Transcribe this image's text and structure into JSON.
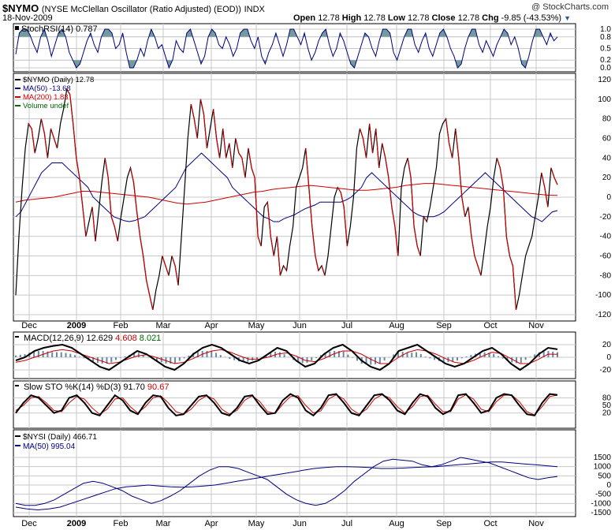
{
  "header": {
    "symbol": "$NYMO",
    "name": "(NYSE McClellan Oscillator (Ratio Adjusted) (EOD))",
    "exchange": "INDX",
    "date": "18-Nov-2009",
    "watermark": "@ StockCharts.com",
    "open_label": "Open",
    "open": "12.78",
    "high_label": "High",
    "high": "12.78",
    "low_label": "Low",
    "low": "12.78",
    "close_label": "Close",
    "close": "12.78",
    "chg_label": "Chg",
    "chg": "-9.85 (-43.53%)"
  },
  "colors": {
    "black": "#000000",
    "navy": "#00007f",
    "red": "#cc0000",
    "green": "#006600",
    "hist": "#6688aa",
    "teal": "#5a8a8a",
    "grid": "#c8c8c8",
    "axis": "#333333"
  },
  "chart_data": [
    {
      "id": "stochrsi",
      "type": "area",
      "legend": "StochRSI(14) 0.787",
      "ylim": [
        0,
        1.0
      ],
      "yticks": [
        "1.0",
        "0.8",
        "0.5",
        "0.2",
        "0.0"
      ],
      "ytick_values": [
        1.0,
        0.8,
        0.5,
        0.2,
        0.0
      ],
      "series": [
        {
          "values": [
            0.35,
            0.9,
            1,
            1,
            0.85,
            0.6,
            0.4,
            0.8,
            1,
            0.7,
            0.3,
            0.6,
            0.9,
            1,
            0.8,
            0.4,
            0.2,
            0,
            0.1,
            0.4,
            0.7,
            0.9,
            0.6,
            0.4,
            0.8,
            1,
            1,
            0.9,
            0.5,
            0.6,
            0.9,
            0.4,
            0,
            0,
            0.2,
            0.5,
            0.3,
            0.7,
            1,
            0.8,
            0.5,
            0.6,
            0.3,
            0,
            0.2,
            0.7,
            0.5,
            0.4,
            0.9,
            1,
            0.7,
            0.4,
            0.1,
            0.3,
            0.8,
            1,
            0.9,
            0.6,
            0.5,
            0.8,
            0.6,
            0.3,
            0.5,
            0.9,
            1,
            1,
            0.7,
            0.5,
            0.8,
            0.3,
            0.1,
            0.4,
            0.6,
            0.9,
            0.6,
            0.3,
            0.6,
            1,
            1,
            0.8,
            0.6,
            0.9,
            0.5,
            0.2,
            0.4,
            0.7,
            0.9,
            1,
            0.6,
            0.3,
            0.5,
            0.9,
            0.7,
            0.4,
            0.1,
            0,
            0.3,
            0.6,
            0.9,
            0.8,
            0.5,
            0.3,
            0.7,
            1,
            1,
            0.9,
            0.4,
            0.2,
            0.5,
            0.8,
            1,
            1,
            0.6,
            0.4,
            0.7,
            0.9,
            0.5,
            0.3,
            0.6,
            0.9,
            1,
            0.8,
            0.5,
            0.3,
            0,
            0.1,
            0.5,
            0.8,
            1,
            1,
            0.6,
            0.4,
            0.7,
            0.5,
            0.3,
            0.6,
            0.8,
            1,
            0.9,
            0.6,
            0.8,
            0.5,
            0.1,
            0,
            0.3,
            0.7,
            1,
            1,
            0.8,
            0.6,
            0.9,
            0.7,
            0.8
          ]
        }
      ]
    },
    {
      "id": "nymo",
      "type": "line",
      "legend": [
        "$NYMO (Daily) 12.78",
        "MA(50) -13.68",
        "MA(200) 1.83",
        "Volume undef"
      ],
      "ylim": [
        -120,
        120
      ],
      "yticks": [
        "120",
        "100",
        "80",
        "60",
        "40",
        "20",
        "0",
        "-20",
        "-40",
        "-60",
        "-80",
        "-100",
        "-120"
      ],
      "ytick_values": [
        120,
        100,
        80,
        60,
        40,
        20,
        0,
        -20,
        -40,
        -60,
        -80,
        -100,
        -120
      ],
      "series": [
        {
          "name": "$NYMO (Daily) 12.78",
          "values": [
            -100,
            -40,
            10,
            50,
            75,
            70,
            45,
            60,
            80,
            65,
            40,
            70,
            60,
            50,
            75,
            90,
            110,
            105,
            75,
            40,
            20,
            -10,
            -40,
            -25,
            -10,
            -45,
            -15,
            15,
            40,
            20,
            -20,
            -30,
            -45,
            -20,
            0,
            20,
            30,
            15,
            -15,
            -40,
            -60,
            -85,
            -100,
            -115,
            -95,
            -80,
            -60,
            -70,
            -80,
            -60,
            -70,
            -90,
            -40,
            10,
            60,
            95,
            80,
            60,
            100,
            85,
            50,
            70,
            90,
            60,
            40,
            70,
            40,
            55,
            30,
            60,
            45,
            40,
            20,
            50,
            30,
            20,
            -40,
            -50,
            -10,
            -5,
            -40,
            -60,
            -40,
            -80,
            -70,
            -75,
            -50,
            -30,
            10,
            20,
            30,
            50,
            10,
            -30,
            -60,
            -75,
            -70,
            -80,
            -60,
            -30,
            0,
            10,
            5,
            -10,
            -50,
            -30,
            0,
            50,
            70,
            60,
            40,
            75,
            45,
            70,
            30,
            55,
            40,
            20,
            -10,
            -30,
            -60,
            10,
            30,
            40,
            20,
            -30,
            -50,
            -60,
            -20,
            -25,
            -10,
            10,
            30,
            65,
            75,
            80,
            55,
            40,
            70,
            40,
            0,
            -20,
            -10,
            -40,
            -60,
            -70,
            -80,
            -55,
            -30,
            -10,
            20,
            40,
            30,
            10,
            -40,
            -60,
            -70,
            -115,
            -100,
            -80,
            -60,
            -50,
            -40,
            -20,
            0,
            25,
            10,
            -10,
            30,
            20,
            12.78
          ]
        },
        {
          "name": "MA(50) -13.68",
          "values": [
            -20,
            -15,
            -5,
            5,
            15,
            25,
            30,
            35,
            35,
            35,
            30,
            25,
            20,
            15,
            10,
            0,
            -5,
            -10,
            -15,
            -20,
            -22,
            -24,
            -25,
            -24,
            -22,
            -20,
            -15,
            -10,
            -5,
            0,
            5,
            10,
            20,
            30,
            35,
            40,
            45,
            40,
            35,
            30,
            25,
            20,
            10,
            5,
            0,
            -5,
            -10,
            -15,
            -20,
            -22,
            -25,
            -25,
            -22,
            -20,
            -18,
            -15,
            -12,
            -10,
            -8,
            -5,
            -5,
            -5,
            -5,
            -5,
            -3,
            0,
            5,
            10,
            20,
            25,
            20,
            15,
            10,
            5,
            0,
            -5,
            -10,
            -15,
            -18,
            -20,
            -20,
            -20,
            -18,
            -15,
            -10,
            -5,
            0,
            5,
            10,
            15,
            20,
            25,
            20,
            15,
            10,
            5,
            0,
            -5,
            -10,
            -15,
            -20,
            -22,
            -25,
            -20,
            -15,
            -13.68
          ]
        },
        {
          "name": "MA(200) 1.83",
          "values": [
            -5,
            -3,
            -2,
            -1,
            0,
            2,
            4,
            6,
            6,
            5,
            4,
            3,
            2,
            1,
            0,
            -2,
            -4,
            -6,
            -7,
            -6,
            -5,
            -3,
            -1,
            1,
            3,
            5,
            6,
            8,
            9,
            10,
            11,
            12,
            11,
            10,
            9,
            8,
            7,
            7,
            8,
            9,
            10,
            12,
            13,
            14,
            14,
            13,
            12,
            11,
            10,
            9,
            8,
            7,
            6,
            5,
            4,
            3,
            2,
            1.83
          ]
        }
      ]
    },
    {
      "id": "macd",
      "type": "line",
      "legend": [
        "MACD(12,26,9)",
        "12.629",
        "4.608",
        "8.021"
      ],
      "ylim": [
        -20,
        20
      ],
      "yticks": [
        "20",
        "0",
        "-20"
      ],
      "ytick_values": [
        20,
        0,
        -20
      ],
      "series": [
        {
          "name": "MACD(12,26,9) 12.629",
          "values": [
            -5,
            0,
            10,
            15,
            18,
            20,
            15,
            5,
            -5,
            -15,
            -20,
            -10,
            0,
            10,
            5,
            -5,
            -15,
            -20,
            -10,
            5,
            15,
            20,
            15,
            5,
            -5,
            -10,
            -5,
            5,
            15,
            10,
            -5,
            -15,
            -10,
            5,
            15,
            20,
            10,
            -5,
            -15,
            -20,
            -10,
            10,
            15,
            20,
            10,
            0,
            -10,
            -15,
            -10,
            0,
            10,
            15,
            5,
            -10,
            -20,
            -10,
            5,
            15,
            12.629
          ]
        },
        {
          "name": "4.608",
          "values": [
            -8,
            -5,
            0,
            5,
            10,
            12,
            10,
            5,
            0,
            -5,
            -10,
            -8,
            -3,
            2,
            4,
            0,
            -5,
            -10,
            -8,
            -2,
            5,
            10,
            12,
            8,
            2,
            -3,
            -3,
            0,
            5,
            7,
            2,
            -5,
            -7,
            -2,
            5,
            10,
            10,
            5,
            -3,
            -10,
            -10,
            0,
            8,
            12,
            10,
            5,
            -2,
            -8,
            -10,
            -5,
            2,
            8,
            6,
            -2,
            -10,
            -10,
            -3,
            5,
            4.608
          ]
        },
        {
          "name": "8.021",
          "values": [
            3,
            5,
            10,
            10,
            8,
            8,
            5,
            0,
            -5,
            -10,
            -10,
            -2,
            3,
            8,
            1,
            -5,
            -10,
            -10,
            -2,
            7,
            10,
            10,
            3,
            -3,
            -7,
            -7,
            -2,
            5,
            10,
            3,
            -7,
            -10,
            -3,
            7,
            10,
            10,
            0,
            -10,
            -12,
            -10,
            0,
            10,
            7,
            8,
            0,
            -5,
            -8,
            -7,
            0,
            5,
            8,
            7,
            -1,
            -8,
            -10,
            0,
            8,
            10,
            8.021
          ]
        }
      ]
    },
    {
      "id": "slowsto",
      "type": "line",
      "legend": [
        "Slow STO %K(14) %D(3)",
        "91.70",
        "90.67"
      ],
      "ylim": [
        0,
        100
      ],
      "yticks": [
        "80",
        "50",
        "20"
      ],
      "ytick_values": [
        80,
        50,
        20
      ],
      "series": [
        {
          "name": "%K(14) 91.70",
          "values": [
            20,
            60,
            90,
            80,
            50,
            20,
            30,
            80,
            90,
            60,
            20,
            10,
            50,
            90,
            70,
            30,
            15,
            60,
            90,
            85,
            40,
            10,
            15,
            50,
            85,
            90,
            60,
            20,
            10,
            40,
            85,
            90,
            50,
            15,
            20,
            70,
            95,
            80,
            30,
            10,
            40,
            90,
            95,
            60,
            20,
            10,
            50,
            90,
            95,
            70,
            30,
            15,
            60,
            95,
            85,
            40,
            15,
            30,
            90,
            95,
            60,
            20,
            30,
            80,
            95,
            90,
            50,
            15,
            10,
            60,
            95,
            91.7
          ]
        },
        {
          "name": "%D(3) 90.67",
          "values": [
            30,
            50,
            80,
            85,
            60,
            30,
            25,
            60,
            85,
            75,
            40,
            15,
            35,
            75,
            80,
            45,
            20,
            45,
            80,
            88,
            60,
            25,
            15,
            35,
            70,
            88,
            75,
            35,
            15,
            30,
            70,
            88,
            65,
            25,
            18,
            55,
            85,
            88,
            50,
            20,
            28,
            75,
            92,
            75,
            35,
            15,
            35,
            75,
            92,
            80,
            45,
            20,
            45,
            85,
            90,
            55,
            25,
            25,
            75,
            92,
            75,
            35,
            25,
            65,
            90,
            92,
            65,
            25,
            12,
            45,
            85,
            90.67
          ]
        }
      ]
    },
    {
      "id": "nysi",
      "type": "line",
      "legend": [
        "$NYSI (Daily) 466.71",
        "MA(50) 995.04"
      ],
      "ylim": [
        -1500,
        1500
      ],
      "yticks": [
        "1500",
        "1000",
        "500",
        "0",
        "-500",
        "-1000",
        "-1500"
      ],
      "ytick_values": [
        1500,
        1000,
        500,
        0,
        -500,
        -1000,
        -1500
      ],
      "series": [
        {
          "name": "$NYSI (Daily) 466.71",
          "values": [
            -1000,
            -1100,
            -1100,
            -1000,
            -800,
            -500,
            -200,
            100,
            200,
            100,
            -100,
            -300,
            -600,
            -800,
            -1000,
            -850,
            -600,
            -300,
            100,
            500,
            800,
            1000,
            1000,
            900,
            700,
            500,
            300,
            -100,
            -500,
            -800,
            -1000,
            -1100,
            -1000,
            -700,
            -300,
            200,
            600,
            1000,
            1300,
            1400,
            1350,
            1300,
            1100,
            1000,
            1100,
            1300,
            1500,
            1400,
            1300,
            1200,
            1000,
            800,
            600,
            400,
            300,
            400,
            466.71
          ]
        },
        {
          "name": "MA(50) 995.04",
          "values": [
            -1200,
            -1300,
            -1350,
            -1300,
            -1200,
            -1000,
            -800,
            -600,
            -400,
            -200,
            -100,
            -50,
            0,
            -50,
            -100,
            -120,
            -100,
            -50,
            0,
            100,
            200,
            300,
            400,
            500,
            600,
            700,
            800,
            900,
            950,
            1000,
            1000,
            980,
            950,
            900,
            900,
            920,
            950,
            980,
            1000,
            1050,
            1100,
            1150,
            1200,
            1250,
            1250,
            1200,
            1150,
            1100,
            1050,
            995.04
          ]
        }
      ]
    }
  ],
  "x_axis_labels": [
    "Dec",
    "2009",
    "Feb",
    "Mar",
    "Apr",
    "May",
    "Jun",
    "Jul",
    "Aug",
    "Sep",
    "Oct",
    "Nov"
  ]
}
